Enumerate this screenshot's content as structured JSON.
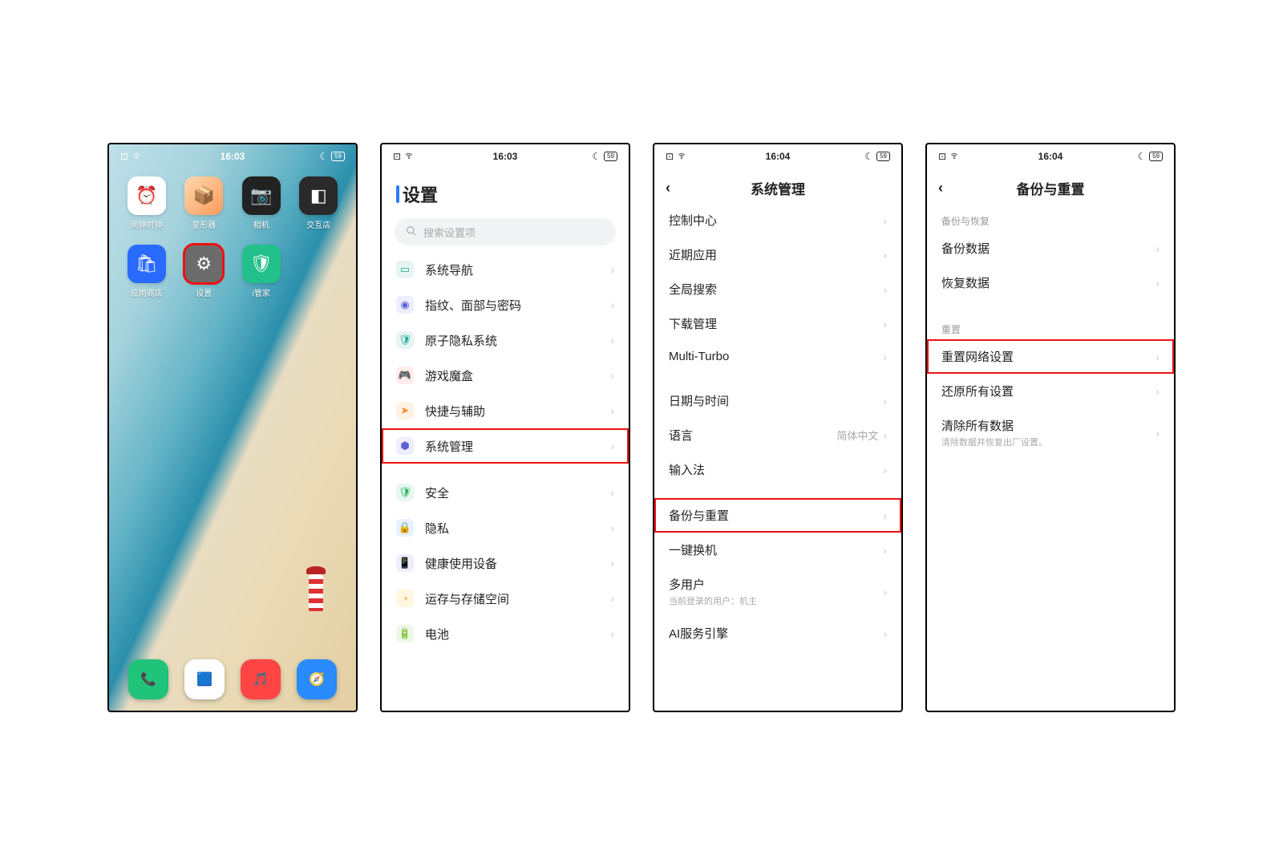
{
  "status": {
    "time1": "16:03",
    "time2": "16:03",
    "time3": "16:04",
    "time4": "16:04",
    "battery": "59"
  },
  "home": {
    "apps": [
      {
        "label": "闹钟时钟",
        "bg": "#fff",
        "emoji": "⏰"
      },
      {
        "label": "变形器",
        "bg": "linear-gradient(135deg,#ffd8b0,#ff9a5a)",
        "emoji": "📦"
      },
      {
        "label": "相机",
        "bg": "#222",
        "emoji": "📷"
      },
      {
        "label": "交互店",
        "bg": "#2a2a2a",
        "emoji": "◧"
      },
      {
        "label": "应用商店",
        "bg": "#2a6bff",
        "emoji": "🛍"
      },
      {
        "label": "设置",
        "bg": "#6c6c6c",
        "emoji": "⚙"
      },
      {
        "label": "i管家",
        "bg": "#22c08a",
        "emoji": "🛡"
      }
    ],
    "dock": [
      {
        "bg": "#1fc47a",
        "emoji": "📞"
      },
      {
        "bg": "#fff",
        "emoji": "🟦"
      },
      {
        "bg": "#ff4444",
        "emoji": "🎵"
      },
      {
        "bg": "#2a8bff",
        "emoji": "🧭"
      }
    ]
  },
  "settings": {
    "title": "设置",
    "search_placeholder": "搜索设置项",
    "group1": [
      {
        "label": "系统导航",
        "cls": "c-teal",
        "glyph": "▭"
      },
      {
        "label": "指纹、面部与密码",
        "cls": "c-indigo",
        "glyph": "◉"
      },
      {
        "label": "原子隐私系统",
        "cls": "c-teal",
        "glyph": "🛡"
      },
      {
        "label": "游戏魔盒",
        "cls": "c-red",
        "glyph": "🎮"
      },
      {
        "label": "快捷与辅助",
        "cls": "c-orange",
        "glyph": "➤"
      },
      {
        "label": "系统管理",
        "cls": "c-indigo",
        "glyph": "⬢",
        "hl": true
      }
    ],
    "group2": [
      {
        "label": "安全",
        "cls": "c-green",
        "glyph": "🛡"
      },
      {
        "label": "隐私",
        "cls": "c-blue",
        "glyph": "🔒"
      },
      {
        "label": "健康使用设备",
        "cls": "c-indigo",
        "glyph": "📱"
      },
      {
        "label": "运存与存储空间",
        "cls": "c-yellow",
        "glyph": "◔"
      },
      {
        "label": "电池",
        "cls": "c-lgreen",
        "glyph": "🔋"
      }
    ]
  },
  "sysmgmt": {
    "title": "系统管理",
    "rows1": [
      {
        "label": "控制中心"
      },
      {
        "label": "近期应用"
      },
      {
        "label": "全局搜索"
      },
      {
        "label": "下载管理"
      },
      {
        "label": "Multi-Turbo"
      }
    ],
    "rows2": [
      {
        "label": "日期与时间"
      },
      {
        "label": "语言",
        "value": "简体中文"
      },
      {
        "label": "输入法"
      }
    ],
    "rows3": [
      {
        "label": "备份与重置",
        "hl": true
      },
      {
        "label": "一键换机"
      },
      {
        "label": "多用户",
        "sub": "当前登录的用户：机主"
      },
      {
        "label": "AI服务引擎"
      }
    ]
  },
  "backup": {
    "title": "备份与重置",
    "sec1_label": "备份与恢复",
    "sec1": [
      {
        "label": "备份数据"
      },
      {
        "label": "恢复数据"
      }
    ],
    "sec2_label": "重置",
    "sec2": [
      {
        "label": "重置网络设置",
        "hl": true
      },
      {
        "label": "还原所有设置"
      },
      {
        "label": "清除所有数据",
        "sub": "清除数据并恢复出厂设置。"
      }
    ]
  }
}
